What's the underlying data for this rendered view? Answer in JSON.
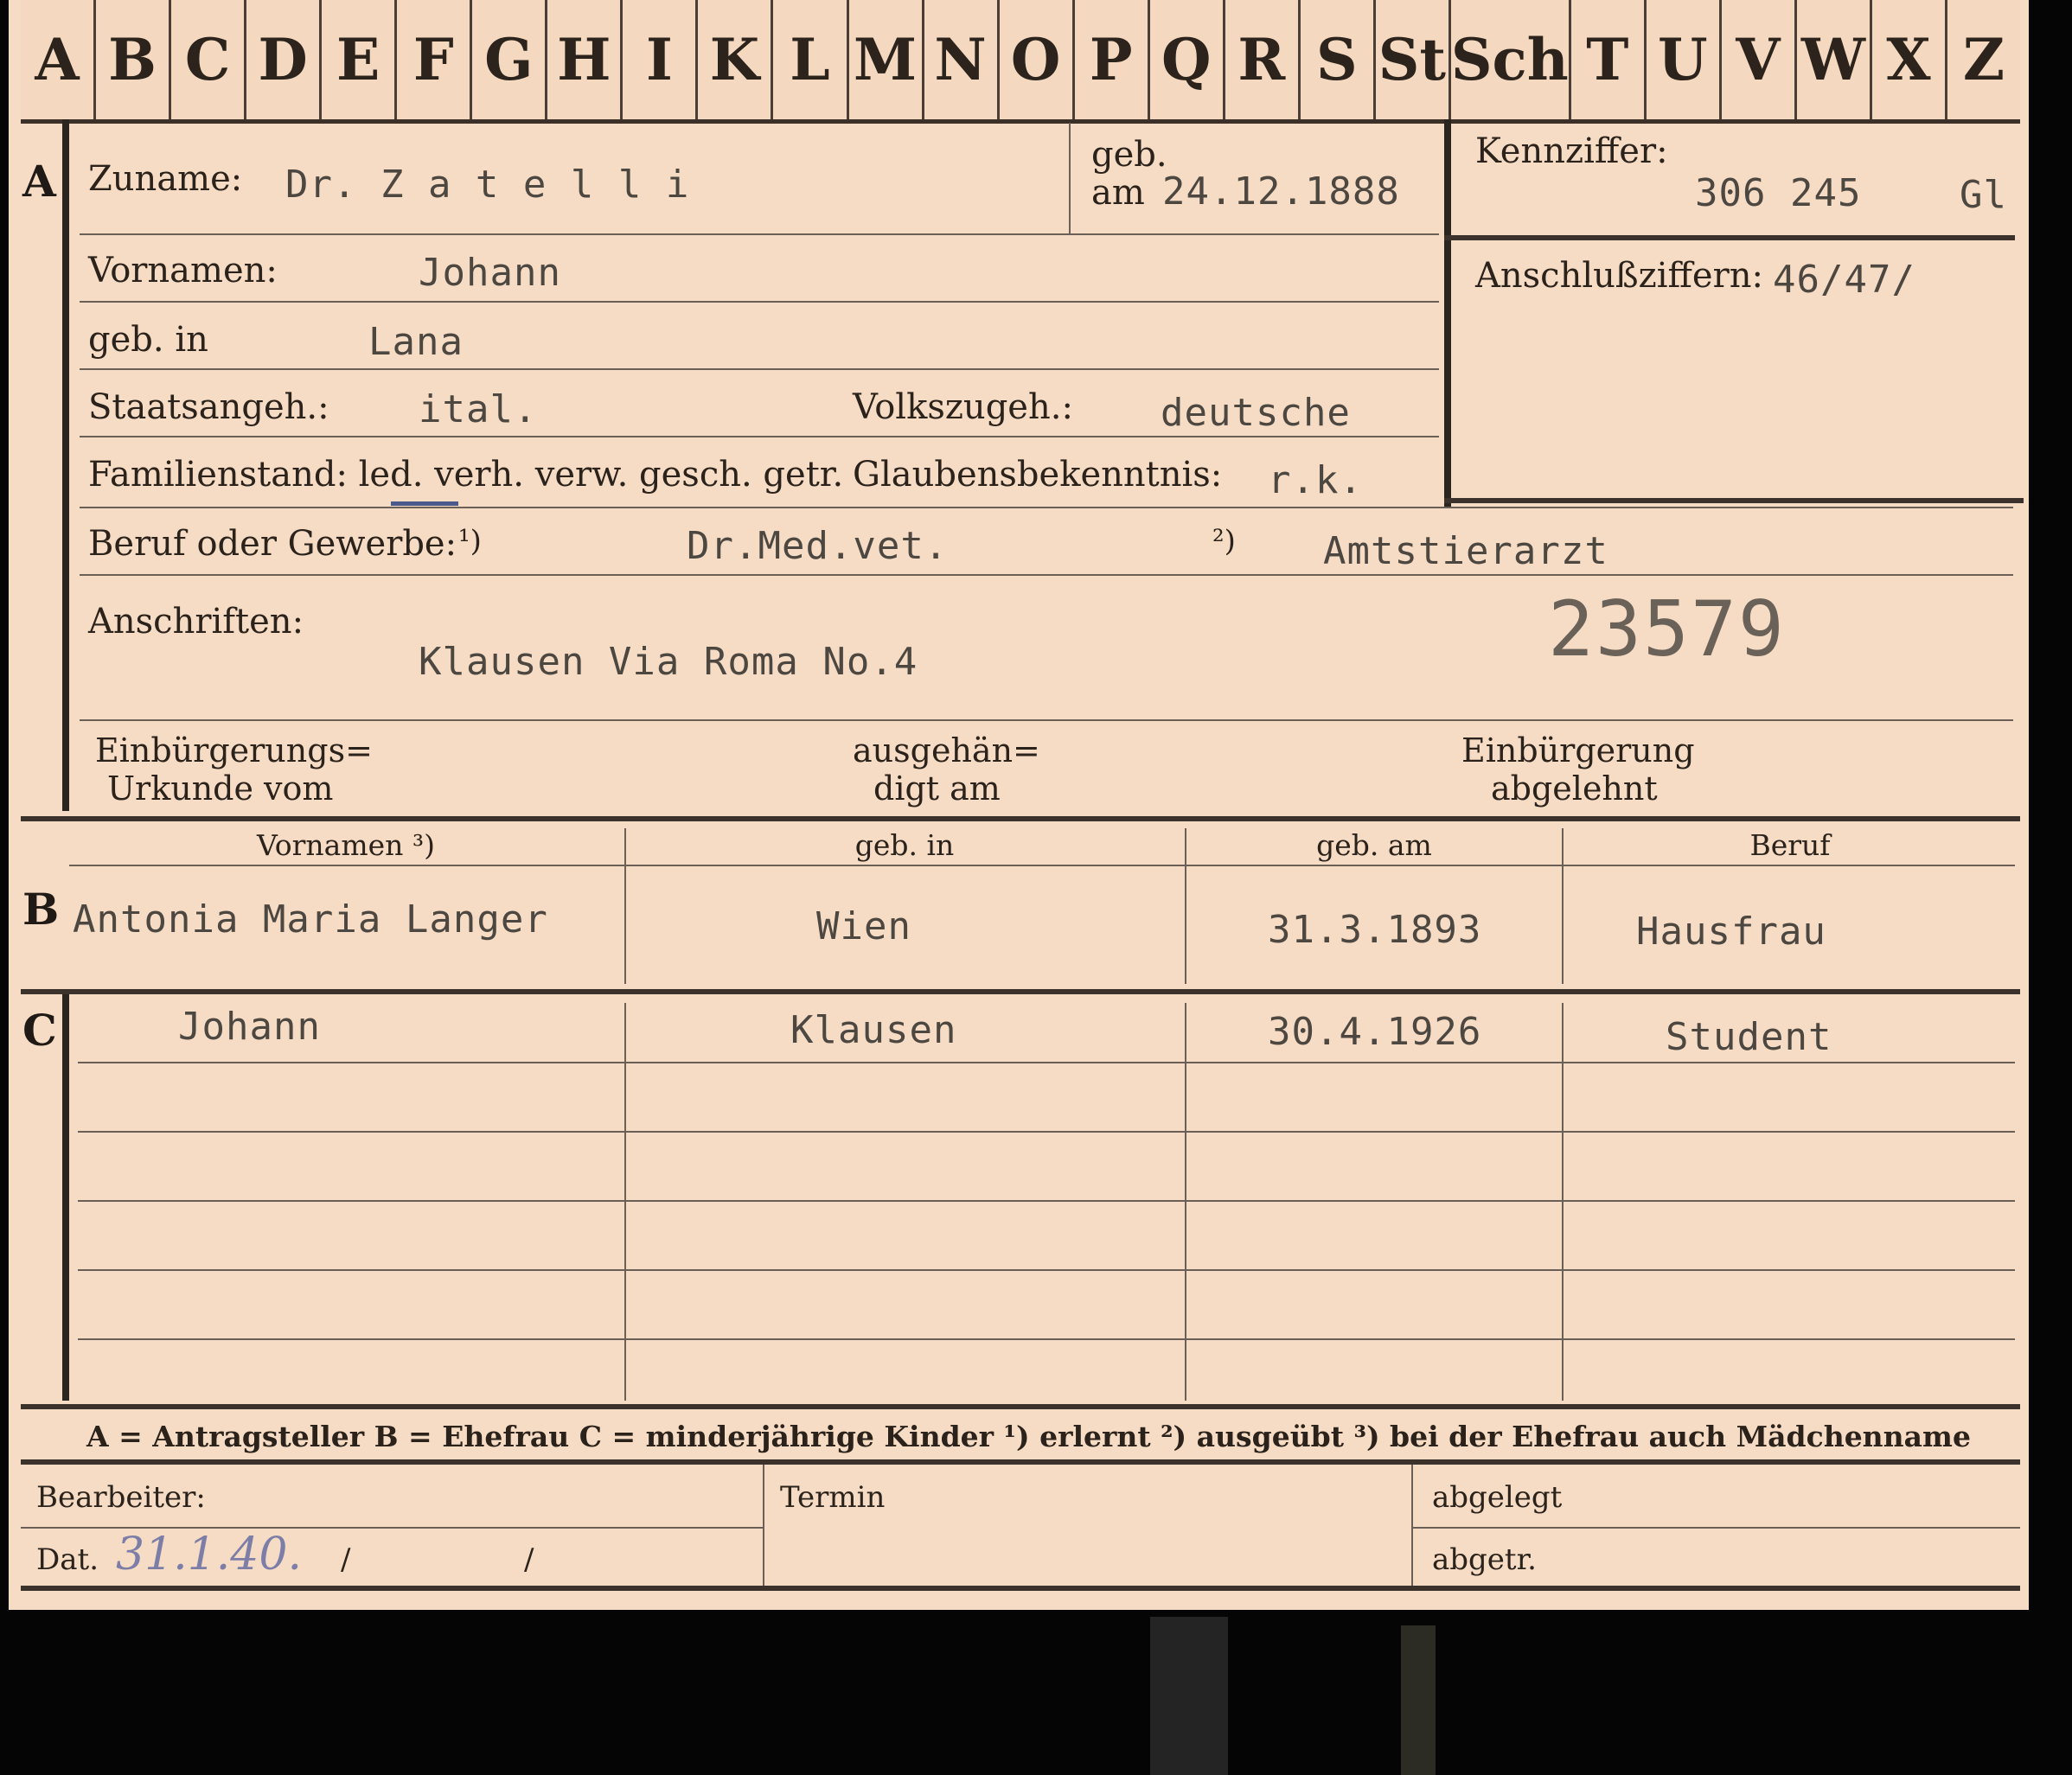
{
  "tabs": [
    "A",
    "B",
    "C",
    "D",
    "E",
    "F",
    "G",
    "H",
    "I",
    "K",
    "L",
    "M",
    "N",
    "O",
    "P",
    "Q",
    "R",
    "S",
    "St",
    "Sch",
    "T",
    "U",
    "V",
    "W",
    "X",
    "Z"
  ],
  "section_letters": {
    "a": "A",
    "b": "B",
    "c": "C"
  },
  "applicant": {
    "surname_label": "Zuname:",
    "surname": "Dr. Z a t e l l i",
    "born_label_1": "geb.",
    "born_label_2": "am",
    "born_date": "24.12.1888",
    "firstname_label": "Vornamen:",
    "firstname": "Johann",
    "birthplace_label": "geb. in",
    "birthplace": "Lana",
    "citizenship_label": "Staatsangeh.:",
    "citizenship": "ital.",
    "ethnicity_label": "Volkszugeh.:",
    "ethnicity": "deutsche",
    "marital_label": "Familienstand: led. verh. verw. gesch. getr.",
    "religion_label": "Glaubensbekenntnis:",
    "religion": "r.k.",
    "profession_label": "Beruf oder Gewerbe:",
    "profession_note1": "¹)",
    "profession_learned": "Dr.Med.vet.",
    "profession_note2": "²)",
    "profession_practiced": "Amtstierarzt",
    "address_label": "Anschriften:",
    "address": "Klausen Via Roma No.4",
    "file_number": "23579",
    "naturalization_cert_label_1": "Einbürgerungs=",
    "naturalization_cert_label_2": "Urkunde vom",
    "handed_label_1": "ausgehän=",
    "handed_label_2": "digt am",
    "rejected_label_1": "Einbürgerung",
    "rejected_label_2": "abgelehnt"
  },
  "id_box": {
    "code_label": "Kennziffer:",
    "code": "306 245",
    "code_suffix": "Gl",
    "link_label": "Anschlußziffern:",
    "link": "46/47/"
  },
  "family_table": {
    "headers": [
      "Vornamen ³)",
      "geb. in",
      "geb. am",
      "Beruf"
    ],
    "wife": [
      "Antonia Maria Langer",
      "Wien",
      "31.3.1893",
      "Hausfrau"
    ],
    "child": [
      "Johann",
      "Klausen",
      "30.4.1926",
      "Student"
    ]
  },
  "legend": "A = Antragsteller   B = Ehefrau   C = minderjährige Kinder   ¹) erlernt   ²) ausgeübt   ³) bei der Ehefrau auch Mädchenname",
  "footer": {
    "clerk_label": "Bearbeiter:",
    "date_label": "Dat.",
    "date_value": "31.1.40.",
    "slash1": "/",
    "slash2": "/",
    "term_label": "Termin",
    "filed_label": "abgelegt",
    "removed_label": "abgetr."
  }
}
